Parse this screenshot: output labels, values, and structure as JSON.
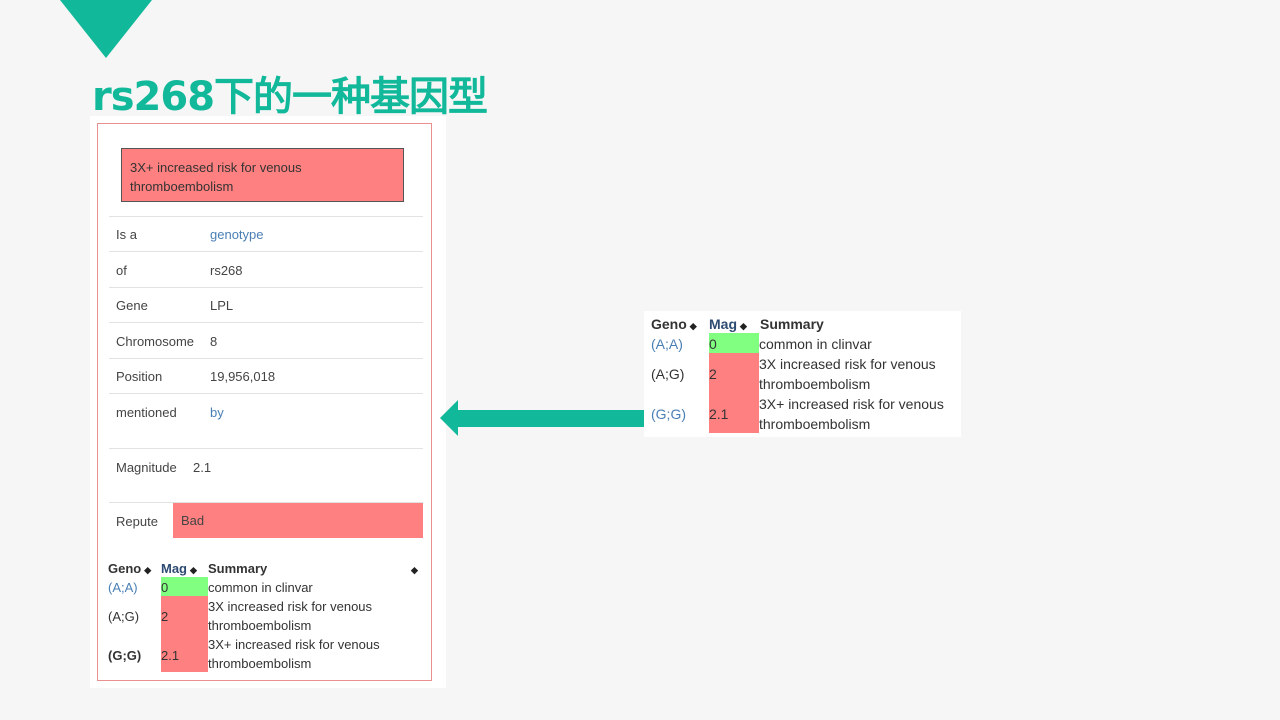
{
  "slide": {
    "title": "rs268下的一种基因型"
  },
  "panel": {
    "summary": "3X+ increased risk for venous thromboembolism",
    "rows": [
      {
        "label": "Is a",
        "value": "genotype"
      },
      {
        "label": "of",
        "value": "rs268"
      },
      {
        "label": "Gene",
        "value": "LPL"
      },
      {
        "label": "Chromosome",
        "value": "8"
      },
      {
        "label": "Position",
        "value": "19,956,018"
      },
      {
        "label": "mentioned",
        "value": "by"
      }
    ],
    "magnitude": {
      "label": "Magnitude",
      "value": "2.1"
    },
    "repute": {
      "label": "Repute",
      "value": "Bad"
    }
  },
  "genotype_table": {
    "headers": {
      "geno": "Geno",
      "mag": "Mag",
      "summary": "Summary"
    },
    "rows": [
      {
        "geno": "(A;A)",
        "mag": "0",
        "summary_l1": "common in clinvar",
        "summary_l2": ""
      },
      {
        "geno": "(A;G)",
        "mag": "2",
        "summary_l1": "3X increased risk for venous",
        "summary_l2": "thromboembolism"
      },
      {
        "geno": "(G;G)",
        "mag": "2.1",
        "summary_l1": "3X+ increased risk for venous",
        "summary_l2": "thromboembolism"
      }
    ]
  },
  "colors": {
    "accent": "#12b89a",
    "bad": "#ff8080",
    "good": "#80ff80",
    "link": "#4a7fb5"
  }
}
